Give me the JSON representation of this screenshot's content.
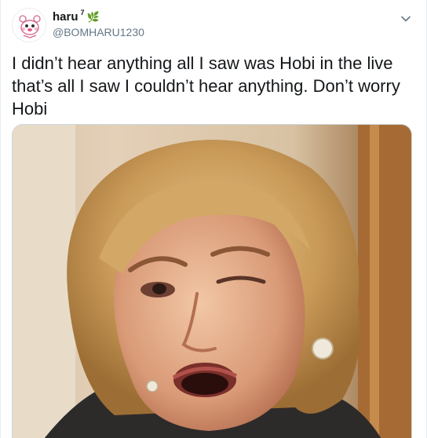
{
  "user": {
    "display_name": "haru",
    "name_superscript": "7",
    "name_emoji": "🌿",
    "handle": "@BOMHARU1230",
    "avatar_icon": "cartoon-avatar-icon"
  },
  "tweet": {
    "text": "I didn’t hear anything all I saw was Hobi in the live\nthat’s all I saw I couldn’t hear anything. Don’t worry\nHobi"
  },
  "menu": {
    "icon": "chevron-down-icon"
  },
  "media": {
    "type": "photo",
    "subject_icon": "reaction-meme-photo"
  },
  "colors": {
    "text": "#14171a",
    "secondary": "#657786",
    "border": "#e6ecf0"
  }
}
